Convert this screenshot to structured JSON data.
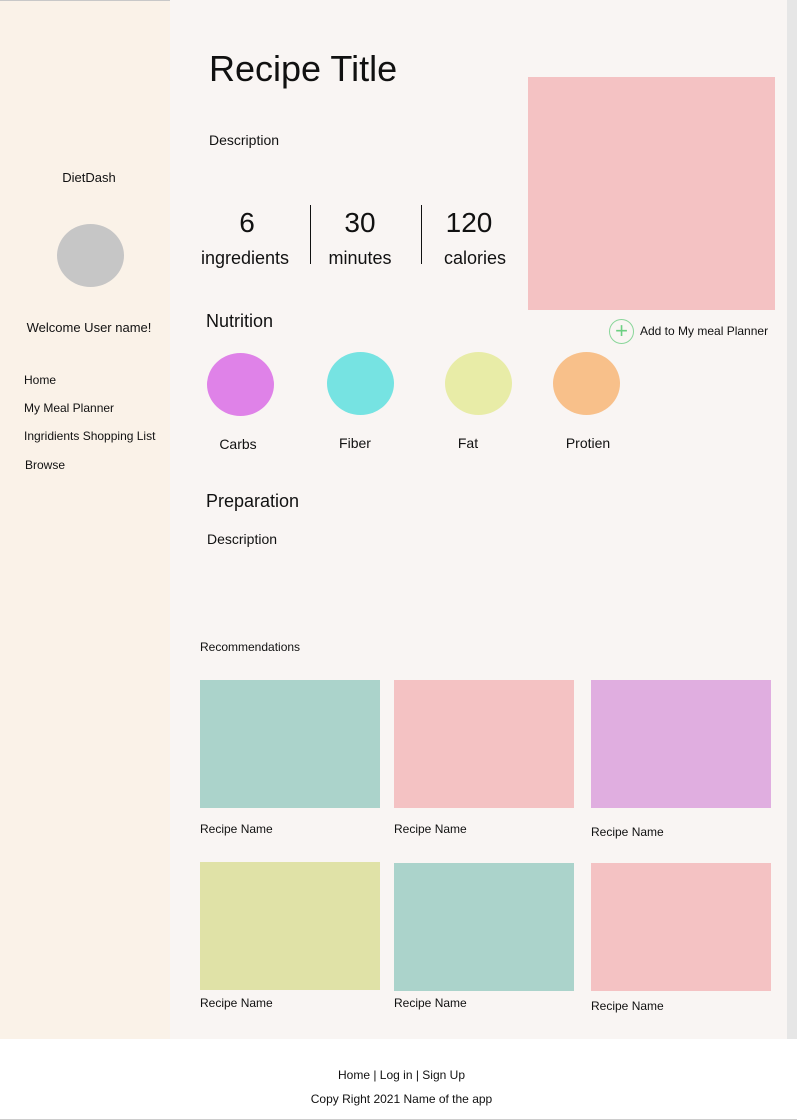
{
  "sidebar": {
    "brand": "DietDash",
    "welcome": "Welcome User name!",
    "nav": [
      "Home",
      "My Meal Planner",
      "Ingridients Shopping List",
      "Browse"
    ]
  },
  "recipe": {
    "title": "Recipe Title",
    "description": "Description",
    "stats": [
      {
        "value": "6",
        "label": "ingredients"
      },
      {
        "value": "30",
        "label": "minutes"
      },
      {
        "value": "120",
        "label": "calories"
      }
    ],
    "add_to_planner": "Add to My meal Planner"
  },
  "nutrition": {
    "heading": "Nutrition",
    "items": [
      {
        "label": "Carbs",
        "color": "#df82e8"
      },
      {
        "label": "Fiber",
        "color": "#76e3e2"
      },
      {
        "label": "Fat",
        "color": "#e8eca7"
      },
      {
        "label": "Protien",
        "color": "#f8c08a"
      }
    ]
  },
  "preparation": {
    "heading": "Preparation",
    "description": "Description"
  },
  "recommendations": {
    "heading": "Recommendations",
    "cards": [
      {
        "name": "Recipe Name",
        "color": "#abd3cb"
      },
      {
        "name": "Recipe Name",
        "color": "#f4c2c3"
      },
      {
        "name": "Recipe Name",
        "color": "#e0aee0"
      },
      {
        "name": "Recipe Name",
        "color": "#e0e2a7"
      },
      {
        "name": "Recipe Name",
        "color": "#abd3cb"
      },
      {
        "name": "Recipe Name",
        "color": "#f4c2c3"
      }
    ]
  },
  "colors": {
    "sidebar_bg": "#faf2e8",
    "main_bg": "#f9f5f3",
    "hero_image": "#f4c2c3",
    "avatar": "#c6c6c6",
    "add_icon": "#6ccf82"
  },
  "footer": {
    "links": [
      "Home",
      "Log in",
      "Sign Up"
    ],
    "separator": " | ",
    "copyright": "Copy Right 2021 Name of the app"
  }
}
